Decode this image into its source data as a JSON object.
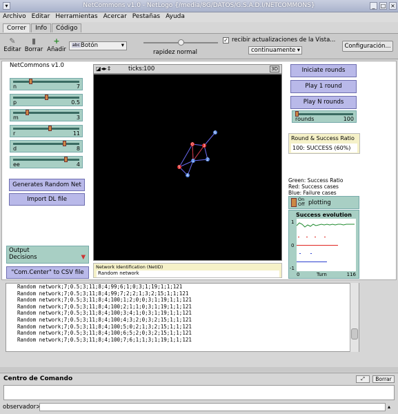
{
  "window": {
    "title": "NetCommons v1.0 - NetLogo {/media/8G/DATOS/G.S.A.D.I/NETCOMMONS}"
  },
  "menu": [
    "Archivo",
    "Editar",
    "Herramientas",
    "Acercar",
    "Pestañas",
    "Ayuda"
  ],
  "tabs": [
    "Correr",
    "Info",
    "Código"
  ],
  "toolbar": {
    "edit": "Editar",
    "delete": "Borrar",
    "add": "Añadir",
    "widget_type": "Botón",
    "speed": "rapidez normal",
    "update_check": "recibir actualizaciones de la Vista...",
    "update_mode": "continuamente",
    "config": "Configuración..."
  },
  "model_title": "NetCommons v1.0",
  "sliders": [
    {
      "name": "n",
      "value": "7",
      "frac": 0.25
    },
    {
      "name": "p",
      "value": "0.5",
      "frac": 0.5
    },
    {
      "name": "m",
      "value": "3",
      "frac": 0.2
    },
    {
      "name": "r",
      "value": "11",
      "frac": 0.55
    },
    {
      "name": "d",
      "value": "8",
      "frac": 0.78
    },
    {
      "name": "ee",
      "value": "4",
      "frac": 0.8
    }
  ],
  "buttons": {
    "generate": "Generates Random Net",
    "import": "Import DL file",
    "initiate": "Iniciate rounds",
    "play1": "Play 1 round",
    "playn": "Play N rounds",
    "csv": "\"Com.Center\" to CSV file"
  },
  "rounds_slider": {
    "name": "rounds",
    "value": "100",
    "frac": 0.0
  },
  "chooser": {
    "label": "Output",
    "value": "Decisions"
  },
  "view": {
    "ticks_label": "ticks:",
    "ticks": "100",
    "three_d": "3D"
  },
  "netid": {
    "label": "Network Identification (NetID)",
    "value": "Random network"
  },
  "success_monitor": {
    "label": "Round & Success Ratio",
    "value": "100: SUCCESS (60%)"
  },
  "legend": [
    "Green: Success Ratio",
    "Red: Success cases",
    "Blue: Failure cases"
  ],
  "switch": {
    "on": "On",
    "off": "Off",
    "label": "plotting"
  },
  "plot": {
    "title": "Success evolution",
    "ymax": "1",
    "ymid": "0",
    "ymin": "-1",
    "xmin": "0",
    "xlabel": "Turn",
    "xmax": "116"
  },
  "output_lines": [
    "Random network;7;0.5;3;11;8;4;99;6;1;0;3;1;19;1;1;121",
    "Random network;7;0.5;3;11;8;4;99;7;2;2;1;3;2;15;1;1;121",
    "Random network;7;0.5;3;11;8;4;100;1;2;0;0;3;1;19;1;1;121",
    "Random network;7;0.5;3;11;8;4;100;2;1;1;0;3;1;19;1;1;121",
    "Random network;7;0.5;3;11;8;4;100;3;4;1;0;3;1;19;1;1;121",
    "Random network;7;0.5;3;11;8;4;100;4;3;2;0;3;2;15;1;1;121",
    "Random network;7;0.5;3;11;8;4;100;5;0;2;1;3;2;15;1;1;121",
    "Random network;7;0.5;3;11;8;4;100;6;5;2;0;3;2;15;1;1;121",
    "Random network;7;0.5;3;11;8;4;100;7;6;1;1;3;1;19;1;1;121"
  ],
  "command_center": {
    "title": "Centro de Comando",
    "clear": "Borrar",
    "prompt": "observador>"
  },
  "colors": {
    "green": "#1e8a2e",
    "red": "#e0231e",
    "blue": "#2a3fd0"
  }
}
